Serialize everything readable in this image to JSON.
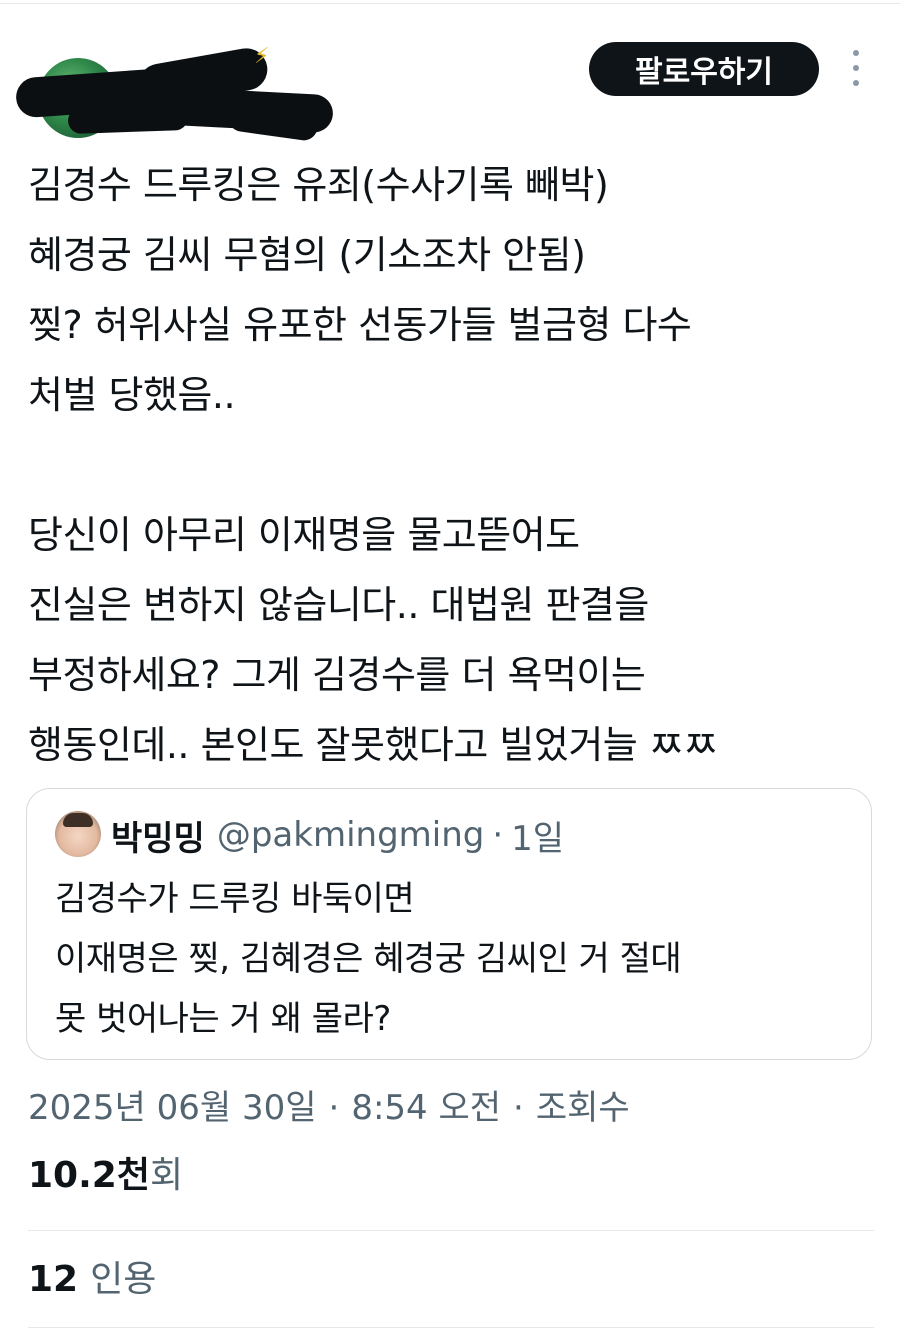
{
  "header": {
    "follow_label": "팔로우하기",
    "more_icon": "more-vertical-icon"
  },
  "tweet": {
    "lines": [
      "김경수 드루킹은 유죄(수사기록 빼박)",
      "혜경궁 김씨 무혐의 (기소조차 안됨)",
      "찢? 허위사실 유포한 선동가들 벌금형 다수",
      "처벌 당했음..",
      "",
      "당신이 아무리 이재명을 물고뜯어도",
      "진실은 변하지 않습니다.. 대법원 판결을",
      "부정하세요? 그게 김경수를 더 욕먹이는",
      "행동인데.. 본인도 잘못했다고 빌었거늘 ㅉㅉ"
    ]
  },
  "quote": {
    "name": "박밍밍",
    "handle": "@pakmingming",
    "dot": "·",
    "time": "1일",
    "lines": [
      "김경수가 드루킹 바둑이면",
      "이재명은 찢, 김혜경은 혜경궁 김씨인 거 절대",
      "못 벗어나는 거 왜 몰라?"
    ]
  },
  "meta": {
    "date": "2025년 06월 30일",
    "sep": "·",
    "time": "8:54 오전",
    "views_label": "조회수",
    "views_count": "10.2천",
    "views_suffix": "회"
  },
  "quotes": {
    "count": "12",
    "label": "인용"
  },
  "colors": {
    "text": "#0f1419",
    "secondary": "#536471",
    "button_bg": "#0f1419",
    "border": "#d5dadf"
  }
}
